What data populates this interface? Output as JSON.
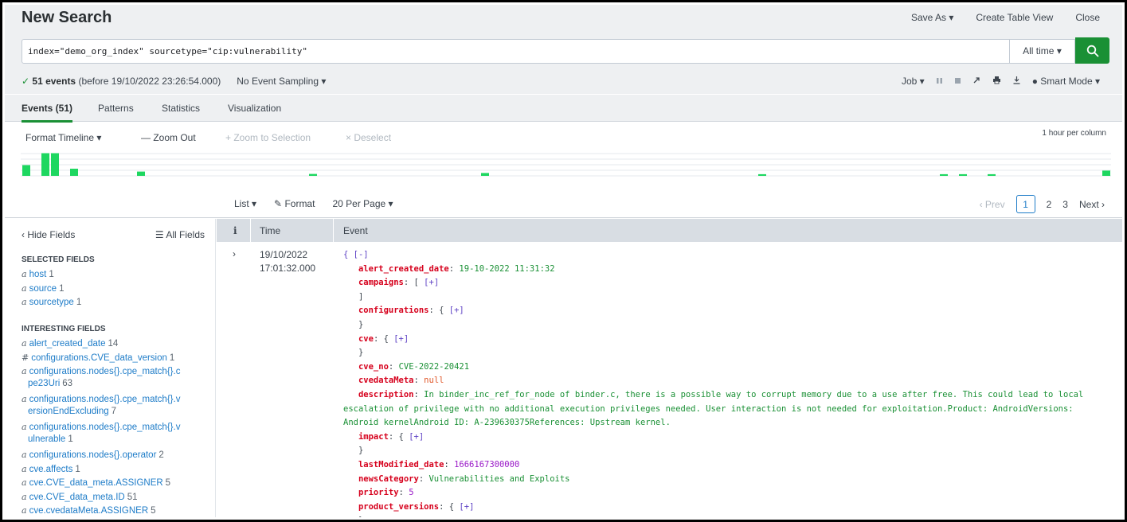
{
  "header": {
    "title": "New Search",
    "save_as": "Save As ▾",
    "create_table_view": "Create Table View",
    "close": "Close"
  },
  "search": {
    "query": "index=\"demo_org_index\" sourcetype=\"cip:vulnerability\"",
    "time_range": "All time ▾"
  },
  "status": {
    "check": "✓",
    "count": "51 events",
    "before": "(before 19/10/2022 23:26:54.000)",
    "sampling": "No Event Sampling ▾",
    "job": "Job ▾",
    "mode": "Smart Mode ▾"
  },
  "tabs": [
    "Events (51)",
    "Patterns",
    "Statistics",
    "Visualization"
  ],
  "timeline": {
    "format": "Format Timeline ▾",
    "zoom_out": "— Zoom Out",
    "zoom_selection": "+ Zoom to Selection",
    "deselect": "× Deselect",
    "scale": "1 hour per column",
    "bar_color": "#1ed760",
    "bars": [
      0.45,
      0.95,
      0.95,
      0.3,
      0.18,
      0.08,
      0.12,
      0.07,
      0.07,
      0.07,
      0.07,
      0.07,
      0.22
    ]
  },
  "results_bar": {
    "list": "List ▾",
    "format": "Format",
    "per_page": "20 Per Page ▾",
    "prev": "‹ Prev",
    "pages": [
      "1",
      "2",
      "3"
    ],
    "next": "Next ›"
  },
  "sidebar": {
    "hide_fields": "‹ Hide Fields",
    "all_fields": "All Fields",
    "selected_title": "SELECTED FIELDS",
    "selected": [
      {
        "type": "a",
        "name": "host",
        "count": "1"
      },
      {
        "type": "a",
        "name": "source",
        "count": "1"
      },
      {
        "type": "a",
        "name": "sourcetype",
        "count": "1"
      }
    ],
    "interesting_title": "INTERESTING FIELDS",
    "interesting": [
      {
        "type": "a",
        "name": "alert_created_date",
        "count": "14"
      },
      {
        "type": "#",
        "name": "configurations.CVE_data_version",
        "count": "1"
      },
      {
        "type": "a",
        "name": "configurations.nodes{}.cpe_match{}.c",
        "cont": "pe23Uri",
        "count": "63"
      },
      {
        "type": "a",
        "name": "configurations.nodes{}.cpe_match{}.v",
        "cont": "ersionEndExcluding",
        "count": "7"
      },
      {
        "type": "a",
        "name": "configurations.nodes{}.cpe_match{}.v",
        "cont": "ulnerable",
        "count": "1"
      },
      {
        "type": "a",
        "name": "configurations.nodes{}.operator",
        "count": "2"
      },
      {
        "type": "a",
        "name": "cve.affects",
        "count": "1"
      },
      {
        "type": "a",
        "name": "cve.CVE_data_meta.ASSIGNER",
        "count": "5"
      },
      {
        "type": "a",
        "name": "cve.CVE_data_meta.ID",
        "count": "51"
      },
      {
        "type": "a",
        "name": "cve.cvedataMeta.ASSIGNER",
        "count": "5"
      }
    ]
  },
  "events_table": {
    "col_info": "i",
    "col_time": "Time",
    "col_event": "Event",
    "row": {
      "caret": "›",
      "date": "19/10/2022",
      "time": "17:01:32.000",
      "open": "{ [-]",
      "alert_created_date_k": "alert_created_date",
      "alert_created_date_v": "19-10-2022 11:31:32",
      "campaigns_k": "campaigns",
      "configurations_k": "configurations",
      "cve_k": "cve",
      "cve_no_k": "cve_no",
      "cve_no_v": "CVE-2022-20421",
      "cvedataMeta_k": "cvedataMeta",
      "cvedataMeta_v": "null",
      "description_k": "description",
      "description_v": "In binder_inc_ref_for_node of binder.c, there is a possible way to corrupt memory due to a use after free. This could lead to local escalation of privilege with no additional execution privileges needed. User interaction is not needed for exploitation.Product: AndroidVersions: Android kernelAndroid ID: A-239630375References: Upstream kernel.",
      "impact_k": "impact",
      "lastModified_date_k": "lastModified_date",
      "lastModified_date_v": "1666167300000",
      "newsCategory_k": "newsCategory",
      "newsCategory_v": "Vulnerabilities and Exploits",
      "priority_k": "priority",
      "priority_v": "5",
      "product_versions_k": "product_versions"
    }
  }
}
